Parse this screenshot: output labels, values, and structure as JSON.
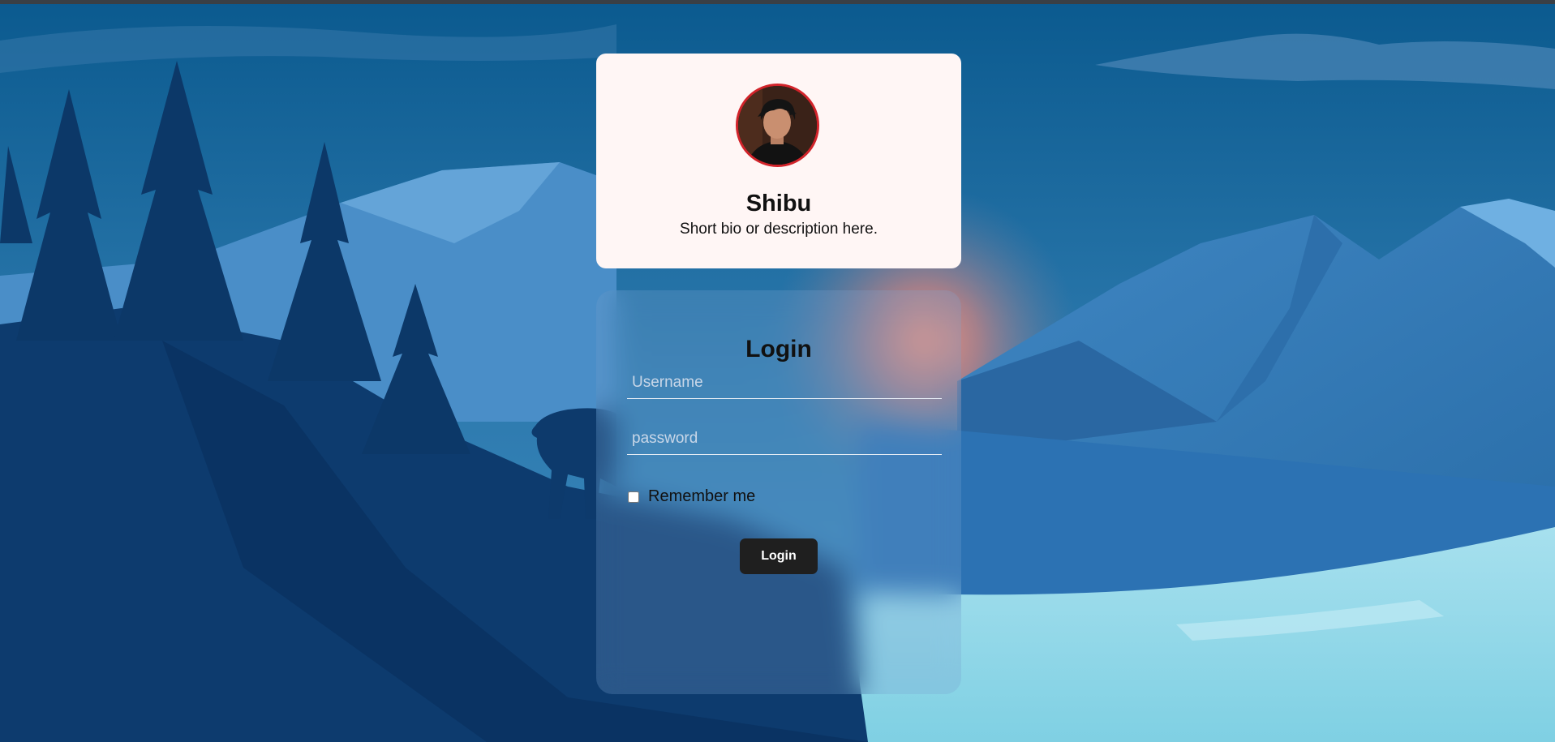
{
  "profile": {
    "name": "Shibu",
    "bio": "Short bio or description here."
  },
  "login": {
    "title": "Login",
    "username_placeholder": "Username",
    "password_placeholder": "password",
    "remember_label": "Remember me",
    "button_label": "Login"
  },
  "colors": {
    "sky_top": "#0b4f84",
    "forest": "#0b3566",
    "snow": "#8fd3e6",
    "sun_glow": "#f28a78",
    "profile_card": "#fff6f5",
    "avatar_border": "#d2232a",
    "button": "#1f1f1f"
  }
}
